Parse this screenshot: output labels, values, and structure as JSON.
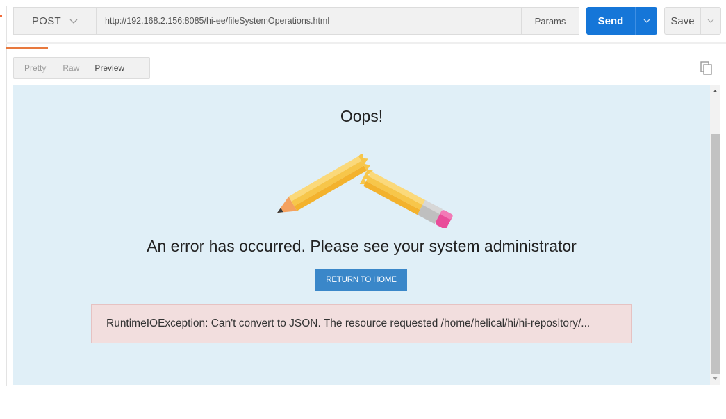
{
  "request": {
    "method": "POST",
    "url": "http://192.168.2.156:8085/hi-ee/fileSystemOperations.html",
    "params_label": "Params",
    "send_label": "Send",
    "save_label": "Save"
  },
  "response_tabs": [
    {
      "label": "Pretty",
      "active": false
    },
    {
      "label": "Raw",
      "active": false
    },
    {
      "label": "Preview",
      "active": true
    }
  ],
  "preview": {
    "heading": "Oops!",
    "message": "An error has occurred. Please see your system administrator",
    "button_label": "RETURN TO HOME",
    "exception": "RuntimeIOException: Can't convert to JSON. The resource requested /home/helical/hi/hi-repository/..."
  },
  "colors": {
    "send": "#1576d8",
    "accent": "#e8793e",
    "preview_bg": "#e0eff7",
    "return_button": "#3a87c9",
    "exception_bg": "#f2dede"
  },
  "icons": [
    "chevron-down-icon",
    "copy-icon",
    "broken-pencil-icon",
    "scroll-up-icon",
    "scroll-down-icon"
  ]
}
